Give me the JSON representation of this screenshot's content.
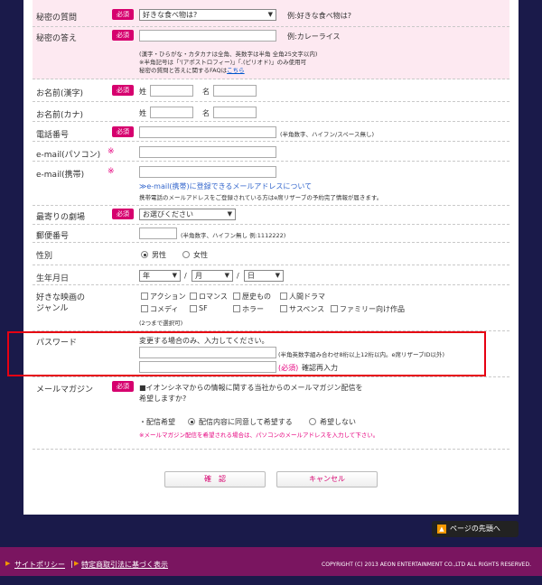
{
  "form": {
    "secret_question": {
      "label": "秘密の質問",
      "required": "必須",
      "select": "好きな食べ物は?",
      "example": "例:好きな食べ物は?"
    },
    "secret_answer": {
      "label": "秘密の答え",
      "required": "必須",
      "example": "例:カレーライス",
      "note1": "(漢字・ひらがな・カタカナは全角、英数字は半角 全角25文字以内)",
      "note2": "※半角記号は「'(アポストロフィー)」「.(ピリオド)」のみ使用可",
      "note3_prefix": "秘密の質問と答えに関するFAQは",
      "note3_link": "こちら"
    },
    "name_kanji": {
      "label": "お名前(漢字)",
      "required": "必須",
      "sei": "姓",
      "mei": "名"
    },
    "name_kana": {
      "label": "お名前(カナ)",
      "sei": "姓",
      "mei": "名"
    },
    "phone": {
      "label": "電話番号",
      "required": "必須",
      "note": "(半角数字、ハイフン/スペース無し)"
    },
    "email_pc": {
      "label": "e-mail(パソコン)",
      "mark": "※"
    },
    "email_mobile": {
      "label": "e-mail(携帯)",
      "mark": "※",
      "link": "≫e-mail(携帯)に登録できるメールアドレスについて",
      "note": "携帯電話のメールアドレスをご登録されている方はe席リザーブの予約完了情報が届きます。"
    },
    "theater": {
      "label": "最寄りの劇場",
      "required": "必須",
      "select": "お選びください"
    },
    "postal": {
      "label": "郵便番号",
      "note": "(半角数字、ハイフン無し 例:1112222)"
    },
    "gender": {
      "label": "性別",
      "male": "男性",
      "female": "女性"
    },
    "birthday": {
      "label": "生年月日",
      "year": "年",
      "month": "月",
      "day": "日",
      "sep": "/"
    },
    "genre": {
      "label1": "好きな映画の",
      "label2": "ジャンル",
      "options": [
        "アクション",
        "ロマンス",
        "歴史もの",
        "人間ドラマ",
        "コメディ",
        "SF",
        "ホラー",
        "サスペンス",
        "ファミリー向け作品"
      ],
      "note": "(2つまで選択可)"
    },
    "password": {
      "label": "パスワード",
      "instruction": "変更する場合のみ、入力してください。",
      "note": "(半角英数字組み合わせ8桁以上12桁以内。e席リザーブID以外)",
      "confirm_required": "(必須)",
      "confirm_label": "確認再入力"
    },
    "newsletter": {
      "label": "メールマガジン",
      "required": "必須",
      "question1": "■イオンシネマからの情報に関する当社からのメールマガジン配信を",
      "question2": "希望しますか?",
      "prefix": "・配信希望",
      "opt_yes": "配信内容に同意して希望する",
      "opt_no": "希望しない",
      "warning": "※メールマガジン配信を希望される場合は、パソコンのメールアドレスを入力して下さい。"
    }
  },
  "buttons": {
    "confirm": "確　認",
    "cancel": "キャンセル"
  },
  "pagetop": "ページの先頭へ",
  "footer": {
    "policy": "サイトポリシー",
    "law": "特定商取引法に基づく表示",
    "copyright": "COPYRIGHT (C) 2013 AEON ENTERTAINMENT CO.,LTD ALL RIGHTS RESERVED."
  },
  "colors": {
    "required": "#d6006e",
    "highlight": "#e60012",
    "footer": "#7a1560",
    "background": "#1a1a4a"
  }
}
